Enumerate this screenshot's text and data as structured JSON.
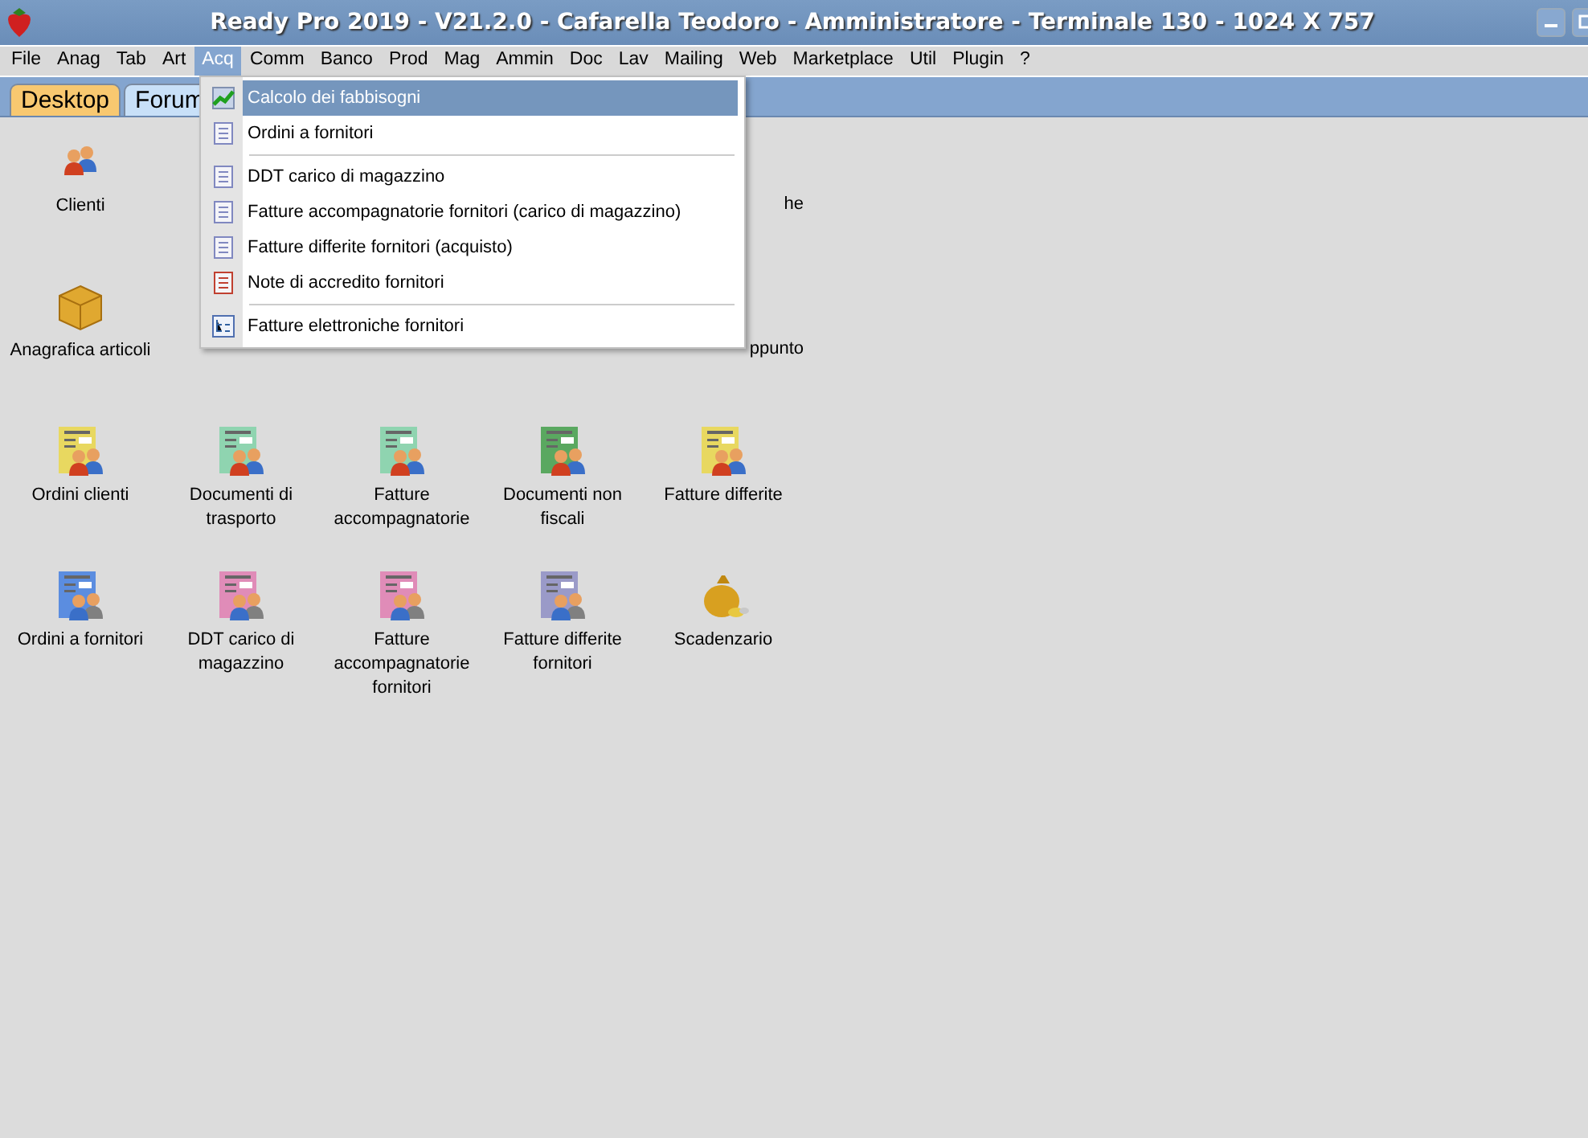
{
  "window": {
    "title": "Ready Pro 2019 - V21.2.0 - Cafarella Teodoro - Amministratore - Terminale 130 - 1024 X 757"
  },
  "menu_bar": [
    {
      "label": "File",
      "selected": false
    },
    {
      "label": "Anag",
      "selected": false
    },
    {
      "label": "Tab",
      "selected": false
    },
    {
      "label": "Art",
      "selected": false
    },
    {
      "label": "Acq",
      "selected": true
    },
    {
      "label": "Comm",
      "selected": false
    },
    {
      "label": "Banco",
      "selected": false
    },
    {
      "label": "Prod",
      "selected": false
    },
    {
      "label": "Mag",
      "selected": false
    },
    {
      "label": "Ammin",
      "selected": false
    },
    {
      "label": "Doc",
      "selected": false
    },
    {
      "label": "Lav",
      "selected": false
    },
    {
      "label": "Mailing",
      "selected": false
    },
    {
      "label": "Web",
      "selected": false
    },
    {
      "label": "Marketplace",
      "selected": false
    },
    {
      "label": "Util",
      "selected": false
    },
    {
      "label": "Plugin",
      "selected": false
    },
    {
      "label": "?",
      "selected": false
    }
  ],
  "tabs": [
    {
      "label": "Desktop",
      "selected": true
    },
    {
      "label": "Forum",
      "selected": false
    }
  ],
  "dropdown": [
    {
      "kind": "chart",
      "label": "Calcolo dei fabbisogni",
      "selected": true
    },
    {
      "kind": "doc",
      "label": "Ordini a fornitori",
      "selected": false
    },
    {
      "kind": "separator"
    },
    {
      "kind": "doc",
      "label": "DDT carico di magazzino",
      "selected": false
    },
    {
      "kind": "doc",
      "label": "Fatture accompagnatorie fornitori (carico di magazzino)",
      "selected": false
    },
    {
      "kind": "doc",
      "label": "Fatture differite fornitori (acquisto)",
      "selected": false
    },
    {
      "kind": "doc-red",
      "label": "Note di accredito fornitori",
      "selected": false
    },
    {
      "kind": "separator"
    },
    {
      "kind": "tree",
      "label": "Fatture elettroniche fornitori",
      "selected": false
    }
  ],
  "desktop": [
    {
      "kind": "people",
      "label": "Clienti"
    },
    {
      "kind": "hidden"
    },
    {
      "kind": "hidden"
    },
    {
      "kind": "hidden"
    },
    {
      "kind": "partial",
      "label": "he"
    },
    {
      "kind": "box",
      "label": "Anagrafica articoli"
    },
    {
      "kind": "hidden"
    },
    {
      "kind": "hidden"
    },
    {
      "kind": "hidden"
    },
    {
      "kind": "partial",
      "label": "ppunto"
    },
    {
      "kind": "doc-people",
      "color": "#e8d860",
      "label": "Ordini clienti"
    },
    {
      "kind": "doc-people",
      "color": "#8fd4b0",
      "label": "Documenti di trasporto"
    },
    {
      "kind": "doc-people",
      "color": "#8fd4b0",
      "label": "Fatture accompagnatorie"
    },
    {
      "kind": "doc-people",
      "color": "#5aa860",
      "label": "Documenti non fiscali"
    },
    {
      "kind": "doc-people",
      "color": "#e8d860",
      "label": "Fatture differite"
    },
    {
      "kind": "doc-suppliers",
      "color": "#5b8de0",
      "label": "Ordini a fornitori"
    },
    {
      "kind": "doc-suppliers",
      "color": "#e08cb8",
      "label": "DDT carico di magazzino"
    },
    {
      "kind": "doc-suppliers",
      "color": "#e08cb8",
      "label": "Fatture accompagnatorie fornitori"
    },
    {
      "kind": "doc-suppliers",
      "color": "#9a9ac8",
      "label": "Fatture differite fornitori"
    },
    {
      "kind": "money",
      "label": "Scadenzario"
    }
  ]
}
